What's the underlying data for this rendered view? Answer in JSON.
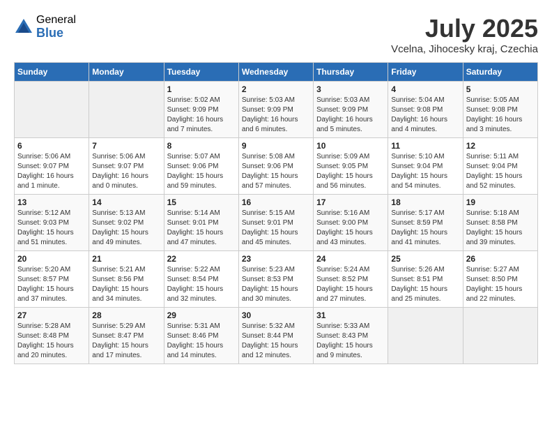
{
  "header": {
    "logo_general": "General",
    "logo_blue": "Blue",
    "month_year": "July 2025",
    "location": "Vcelna, Jihocesky kraj, Czechia"
  },
  "calendar": {
    "days_of_week": [
      "Sunday",
      "Monday",
      "Tuesday",
      "Wednesday",
      "Thursday",
      "Friday",
      "Saturday"
    ],
    "weeks": [
      [
        {
          "day": "",
          "info": ""
        },
        {
          "day": "",
          "info": ""
        },
        {
          "day": "1",
          "info": "Sunrise: 5:02 AM\nSunset: 9:09 PM\nDaylight: 16 hours\nand 7 minutes."
        },
        {
          "day": "2",
          "info": "Sunrise: 5:03 AM\nSunset: 9:09 PM\nDaylight: 16 hours\nand 6 minutes."
        },
        {
          "day": "3",
          "info": "Sunrise: 5:03 AM\nSunset: 9:09 PM\nDaylight: 16 hours\nand 5 minutes."
        },
        {
          "day": "4",
          "info": "Sunrise: 5:04 AM\nSunset: 9:08 PM\nDaylight: 16 hours\nand 4 minutes."
        },
        {
          "day": "5",
          "info": "Sunrise: 5:05 AM\nSunset: 9:08 PM\nDaylight: 16 hours\nand 3 minutes."
        }
      ],
      [
        {
          "day": "6",
          "info": "Sunrise: 5:06 AM\nSunset: 9:07 PM\nDaylight: 16 hours\nand 1 minute."
        },
        {
          "day": "7",
          "info": "Sunrise: 5:06 AM\nSunset: 9:07 PM\nDaylight: 16 hours\nand 0 minutes."
        },
        {
          "day": "8",
          "info": "Sunrise: 5:07 AM\nSunset: 9:06 PM\nDaylight: 15 hours\nand 59 minutes."
        },
        {
          "day": "9",
          "info": "Sunrise: 5:08 AM\nSunset: 9:06 PM\nDaylight: 15 hours\nand 57 minutes."
        },
        {
          "day": "10",
          "info": "Sunrise: 5:09 AM\nSunset: 9:05 PM\nDaylight: 15 hours\nand 56 minutes."
        },
        {
          "day": "11",
          "info": "Sunrise: 5:10 AM\nSunset: 9:04 PM\nDaylight: 15 hours\nand 54 minutes."
        },
        {
          "day": "12",
          "info": "Sunrise: 5:11 AM\nSunset: 9:04 PM\nDaylight: 15 hours\nand 52 minutes."
        }
      ],
      [
        {
          "day": "13",
          "info": "Sunrise: 5:12 AM\nSunset: 9:03 PM\nDaylight: 15 hours\nand 51 minutes."
        },
        {
          "day": "14",
          "info": "Sunrise: 5:13 AM\nSunset: 9:02 PM\nDaylight: 15 hours\nand 49 minutes."
        },
        {
          "day": "15",
          "info": "Sunrise: 5:14 AM\nSunset: 9:01 PM\nDaylight: 15 hours\nand 47 minutes."
        },
        {
          "day": "16",
          "info": "Sunrise: 5:15 AM\nSunset: 9:01 PM\nDaylight: 15 hours\nand 45 minutes."
        },
        {
          "day": "17",
          "info": "Sunrise: 5:16 AM\nSunset: 9:00 PM\nDaylight: 15 hours\nand 43 minutes."
        },
        {
          "day": "18",
          "info": "Sunrise: 5:17 AM\nSunset: 8:59 PM\nDaylight: 15 hours\nand 41 minutes."
        },
        {
          "day": "19",
          "info": "Sunrise: 5:18 AM\nSunset: 8:58 PM\nDaylight: 15 hours\nand 39 minutes."
        }
      ],
      [
        {
          "day": "20",
          "info": "Sunrise: 5:20 AM\nSunset: 8:57 PM\nDaylight: 15 hours\nand 37 minutes."
        },
        {
          "day": "21",
          "info": "Sunrise: 5:21 AM\nSunset: 8:56 PM\nDaylight: 15 hours\nand 34 minutes."
        },
        {
          "day": "22",
          "info": "Sunrise: 5:22 AM\nSunset: 8:54 PM\nDaylight: 15 hours\nand 32 minutes."
        },
        {
          "day": "23",
          "info": "Sunrise: 5:23 AM\nSunset: 8:53 PM\nDaylight: 15 hours\nand 30 minutes."
        },
        {
          "day": "24",
          "info": "Sunrise: 5:24 AM\nSunset: 8:52 PM\nDaylight: 15 hours\nand 27 minutes."
        },
        {
          "day": "25",
          "info": "Sunrise: 5:26 AM\nSunset: 8:51 PM\nDaylight: 15 hours\nand 25 minutes."
        },
        {
          "day": "26",
          "info": "Sunrise: 5:27 AM\nSunset: 8:50 PM\nDaylight: 15 hours\nand 22 minutes."
        }
      ],
      [
        {
          "day": "27",
          "info": "Sunrise: 5:28 AM\nSunset: 8:48 PM\nDaylight: 15 hours\nand 20 minutes."
        },
        {
          "day": "28",
          "info": "Sunrise: 5:29 AM\nSunset: 8:47 PM\nDaylight: 15 hours\nand 17 minutes."
        },
        {
          "day": "29",
          "info": "Sunrise: 5:31 AM\nSunset: 8:46 PM\nDaylight: 15 hours\nand 14 minutes."
        },
        {
          "day": "30",
          "info": "Sunrise: 5:32 AM\nSunset: 8:44 PM\nDaylight: 15 hours\nand 12 minutes."
        },
        {
          "day": "31",
          "info": "Sunrise: 5:33 AM\nSunset: 8:43 PM\nDaylight: 15 hours\nand 9 minutes."
        },
        {
          "day": "",
          "info": ""
        },
        {
          "day": "",
          "info": ""
        }
      ]
    ]
  }
}
